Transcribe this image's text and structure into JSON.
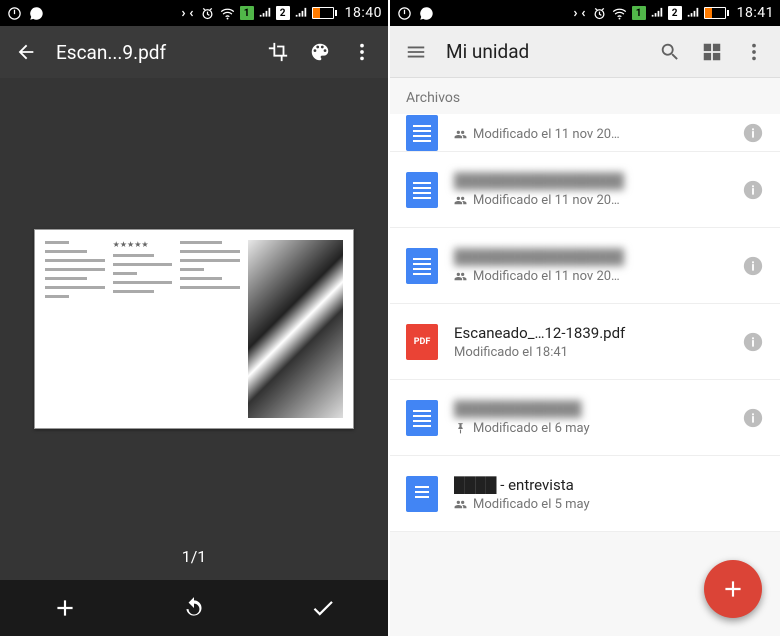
{
  "left": {
    "status": {
      "time": "18:40"
    },
    "appbar": {
      "title": "Escan...9.pdf"
    },
    "scan": {
      "page_counter": "1/1"
    }
  },
  "right": {
    "status": {
      "time": "18:41"
    },
    "appbar": {
      "title": "Mi unidad"
    },
    "section": "Archivos",
    "files": [
      {
        "name": "",
        "meta": "Modificado el 11 nov 20…",
        "type": "docs",
        "shared": true,
        "blur": true
      },
      {
        "name": "████████████████",
        "meta": "Modificado el 11 nov 20…",
        "type": "docs",
        "shared": true,
        "blur": true
      },
      {
        "name": "████████████████",
        "meta": "Modificado el 11 nov 20…",
        "type": "docs",
        "shared": true,
        "blur": true
      },
      {
        "name": "Escaneado_…12-1839.pdf",
        "meta": "Modificado el 18:41",
        "type": "pdf",
        "shared": false,
        "blur": false
      },
      {
        "name": "████████████",
        "meta": "Modificado el 6 may",
        "type": "docs",
        "shared": false,
        "pinned": true,
        "blur": true
      },
      {
        "name": "████ - entrevista",
        "meta": "Modificado el 5 may",
        "type": "docs-text",
        "shared": true,
        "blur": false
      }
    ]
  }
}
